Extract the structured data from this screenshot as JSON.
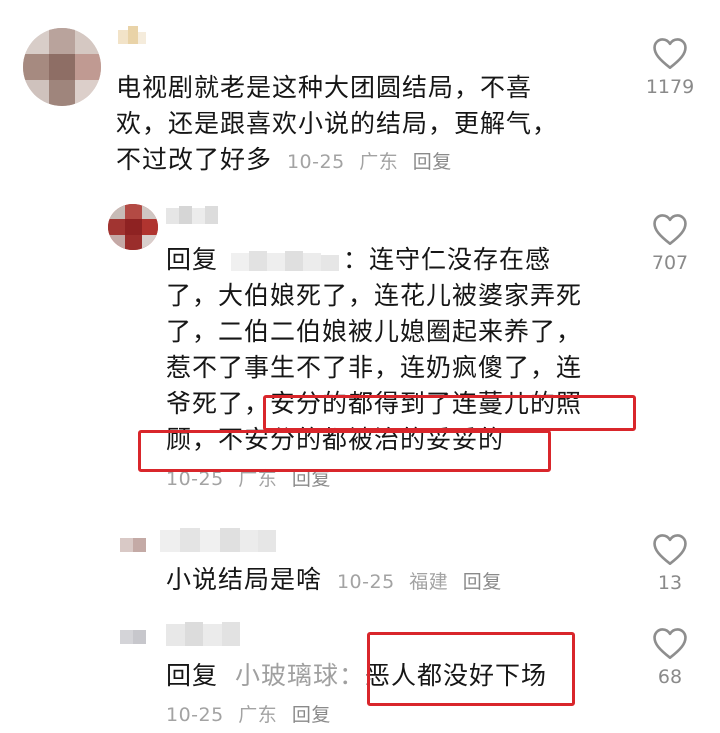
{
  "comments": [
    {
      "text_lines": [
        "电视剧就老是这种大团圆结局，不喜",
        "欢，还是跟喜欢小说的结局，更解气，",
        "不过改了好多"
      ],
      "date": "10-25",
      "location": "广东",
      "reply_label": "回复",
      "likes": "1179"
    },
    {
      "reply_prefix": "回复",
      "line1_after": "：连守仁没存在感",
      "lines": [
        "了，大伯娘死了，连花儿被婆家弄死",
        "了，二伯二伯娘被儿媳圈起来养了，",
        "惹不了事生不了非，连奶疯傻了，连"
      ],
      "line5_a": "爷死了，",
      "line5_b": "安分的都得到了连蔓儿的照",
      "line6": "顾，不安分的都被治的妥妥的",
      "date": "10-25",
      "location": "广东",
      "reply_label": "回复",
      "likes": "707"
    },
    {
      "text": "小说结局是啥",
      "date": "10-25",
      "location": "福建",
      "reply_label": "回复",
      "likes": "13"
    },
    {
      "reply_prefix": "回复",
      "reply_to": "小玻璃球",
      "colon": "：",
      "text": "恶人都没好下场",
      "date": "10-25",
      "location": "广东",
      "reply_label": "回复",
      "likes": "68"
    }
  ],
  "colors": {
    "highlight_border": "#d9262b",
    "meta_text": "#a3a3a3",
    "body_text": "#161616"
  },
  "icons": {
    "like": "heart-outline-icon"
  }
}
